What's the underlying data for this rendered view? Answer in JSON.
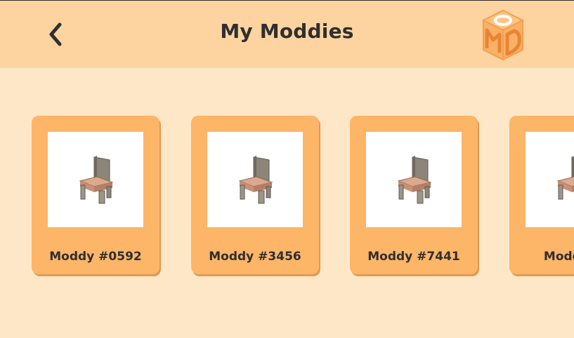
{
  "header": {
    "title": "My Moddies",
    "back_icon": "chevron-left-icon",
    "logo_icon": "moddy-cube-logo"
  },
  "colors": {
    "background": "#fde7c7",
    "header": "#fdd39f",
    "card": "#fdb568",
    "text": "#2f2f2f"
  },
  "moddies": [
    {
      "label": "Moddy #0592",
      "thumbnail_icon": "chair-icon"
    },
    {
      "label": "Moddy #3456",
      "thumbnail_icon": "chair-icon"
    },
    {
      "label": "Moddy #7441",
      "thumbnail_icon": "chair-icon"
    },
    {
      "label": "Moddy #",
      "thumbnail_icon": "chair-icon"
    }
  ]
}
